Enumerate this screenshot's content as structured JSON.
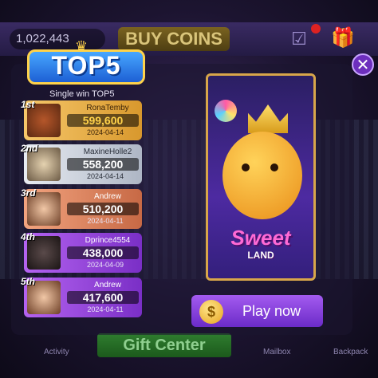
{
  "header": {
    "coin_balance": "1,022,443",
    "buy_coins_label": "BUY COINS"
  },
  "bottom_nav": {
    "activity": "Activity",
    "gift_center": "Gift Center",
    "mailbox": "Mailbox",
    "backpack": "Backpack"
  },
  "modal": {
    "title": "TOP5",
    "subtitle": "Single win TOP5",
    "close_icon": "close-icon",
    "rankings": [
      {
        "place": "1st",
        "name": "RonaTemby",
        "score": "599,600",
        "date": "2024-04-14",
        "style": "gold"
      },
      {
        "place": "2nd",
        "name": "MaxineHolle2",
        "score": "558,200",
        "date": "2024-04-14",
        "style": "silver"
      },
      {
        "place": "3rd",
        "name": "Andrew",
        "score": "510,200",
        "date": "2024-04-11",
        "style": "bronze"
      },
      {
        "place": "4th",
        "name": "Dprince4554",
        "score": "438,000",
        "date": "2024-04-09",
        "style": "purple"
      },
      {
        "place": "5th",
        "name": "Andrew",
        "score": "417,600",
        "date": "2024-04-11",
        "style": "purple"
      }
    ],
    "promo": {
      "game_title_line1": "Sweet",
      "game_title_line2": "LAND"
    },
    "play_button_label": "Play now"
  }
}
